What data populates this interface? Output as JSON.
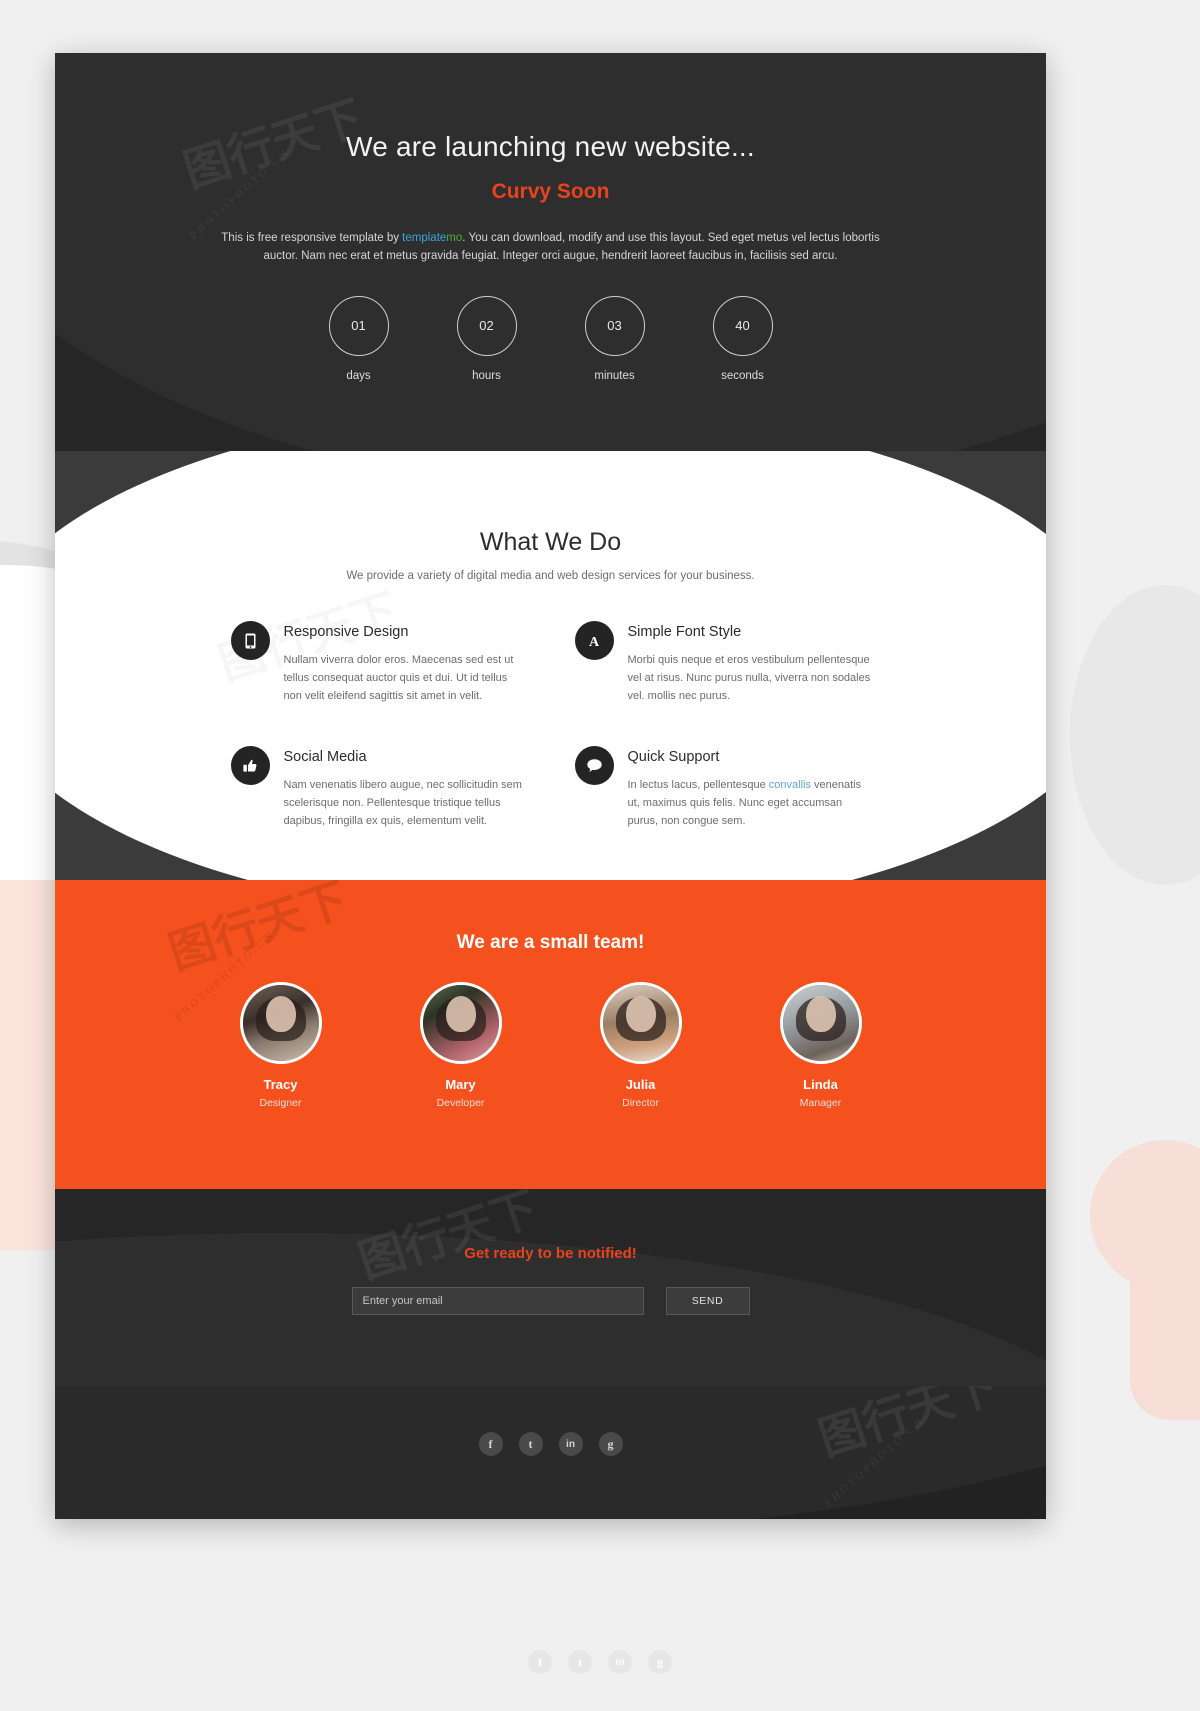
{
  "hero": {
    "title": "We are launching new website...",
    "subtitle": "Curvy Soon",
    "paragraph_pre": "This is free responsive template by ",
    "paragraph_link_blue": "template",
    "paragraph_link_green": "mo",
    "paragraph_post": ". You can download, modify and use this layout. Sed eget metus vel lectus lobortis auctor. Nam nec erat et metus gravida feugiat. Integer orci augue, hendrerit laoreet faucibus in, facilisis sed arcu.",
    "countdown": [
      {
        "value": "01",
        "label": "days"
      },
      {
        "value": "02",
        "label": "hours"
      },
      {
        "value": "03",
        "label": "minutes"
      },
      {
        "value": "40",
        "label": "seconds"
      }
    ]
  },
  "services": {
    "heading": "What We Do",
    "subheading": "We provide a variety of digital media and web design services for your business.",
    "items": [
      {
        "icon": "mobile-phone-icon",
        "title": "Responsive Design",
        "text": "Nullam viverra dolor eros. Maecenas sed est ut tellus consequat auctor quis et dui. Ut id tellus non velit eleifend sagittis sit amet in velit."
      },
      {
        "icon": "letter-a-icon",
        "title": "Simple Font Style",
        "text": "Morbi quis neque et eros vestibulum pellentesque vel at risus. Nunc purus nulla, viverra non sodales vel. mollis nec purus."
      },
      {
        "icon": "thumbs-up-icon",
        "title": "Social Media",
        "text": "Nam venenatis libero augue, nec sollicitudin sem scelerisque non. Pellentesque tristique tellus dapibus, fringilla ex quis, elementum velit."
      },
      {
        "icon": "speech-bubble-icon",
        "title": "Quick Support",
        "text_pre": "In lectus lacus, pellentesque ",
        "text_link": "convallis",
        "text_post": " venenatis ut, maximus quis felis. Nunc eget accumsan purus, non congue sem."
      }
    ]
  },
  "team": {
    "heading": "We are a small team!",
    "members": [
      {
        "name": "Tracy",
        "role": "Designer"
      },
      {
        "name": "Mary",
        "role": "Developer"
      },
      {
        "name": "Julia",
        "role": "Director"
      },
      {
        "name": "Linda",
        "role": "Manager"
      }
    ]
  },
  "notify": {
    "heading": "Get ready to be notified!",
    "email_placeholder": "Enter your email",
    "email_value": "",
    "send_label": "SEND"
  },
  "footer": {
    "socials": [
      {
        "icon": "facebook-icon",
        "glyph": "f"
      },
      {
        "icon": "twitter-icon",
        "glyph": "t"
      },
      {
        "icon": "linkedin-icon",
        "glyph": "in"
      },
      {
        "icon": "google-plus-icon",
        "glyph": "g"
      }
    ]
  },
  "colors": {
    "accent_orange": "#f4511e",
    "accent_red": "#e8431f",
    "dark": "#262626",
    "link_blue": "#3aa5dd",
    "link_green": "#4eae3c"
  },
  "watermark": {
    "text": "PHOTOPHOTO.CN",
    "cn": "图行天下"
  }
}
